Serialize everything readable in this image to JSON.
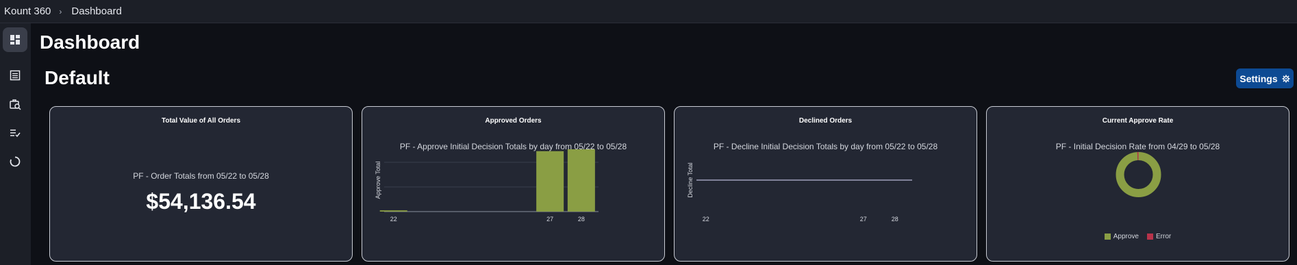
{
  "breadcrumb": {
    "app": "Kount 360",
    "separator": "›",
    "current": "Dashboard"
  },
  "sidebar": {
    "items": [
      {
        "icon": "dashboard-icon",
        "active": true
      },
      {
        "icon": "list-icon",
        "active": false
      },
      {
        "icon": "case-search-icon",
        "active": false
      },
      {
        "icon": "checklist-icon",
        "active": false
      },
      {
        "icon": "circle-refresh-icon",
        "active": false
      }
    ]
  },
  "page": {
    "title": "Dashboard",
    "subtitle": "Default",
    "settings_label": "Settings"
  },
  "colors": {
    "approve": "#8a9e44",
    "error": "#b8334a",
    "accent": "#0d4a93"
  },
  "cards": {
    "total": {
      "title": "Total Value of All Orders",
      "subtitle": "PF - Order Totals from 05/22 to 05/28",
      "value": "$54,136.54"
    },
    "approved": {
      "title": "Approved Orders",
      "subtitle": "PF - Approve Initial Decision Totals by day from 05/22 to 05/28"
    },
    "declined": {
      "title": "Declined Orders",
      "subtitle": "PF - Decline Initial Decision Totals by day from 05/22 to 05/28"
    },
    "rate": {
      "title": "Current Approve Rate",
      "subtitle": "PF - Initial Decision Rate from 04/29 to 05/28",
      "legend": [
        "Approve",
        "Error"
      ]
    }
  },
  "chart_data": [
    {
      "type": "bar",
      "title": "PF - Approve Initial Decision Totals by day from 05/22 to 05/28",
      "ylabel": "Approve Total",
      "x": [
        "22",
        "27",
        "28"
      ],
      "values": [
        0.02,
        0.97,
        1.0
      ],
      "grid": true
    },
    {
      "type": "line",
      "title": "PF - Decline Initial Decision Totals by day from 05/22 to 05/28",
      "ylabel": "Decline Total",
      "x": [
        "22",
        "27",
        "28"
      ],
      "values": [
        0,
        0,
        0
      ]
    },
    {
      "type": "pie",
      "title": "PF - Initial Decision Rate from 04/29 to 05/28",
      "labels": [
        "Approve",
        "Error"
      ],
      "values": [
        99,
        1
      ],
      "legend": "bottom"
    }
  ]
}
